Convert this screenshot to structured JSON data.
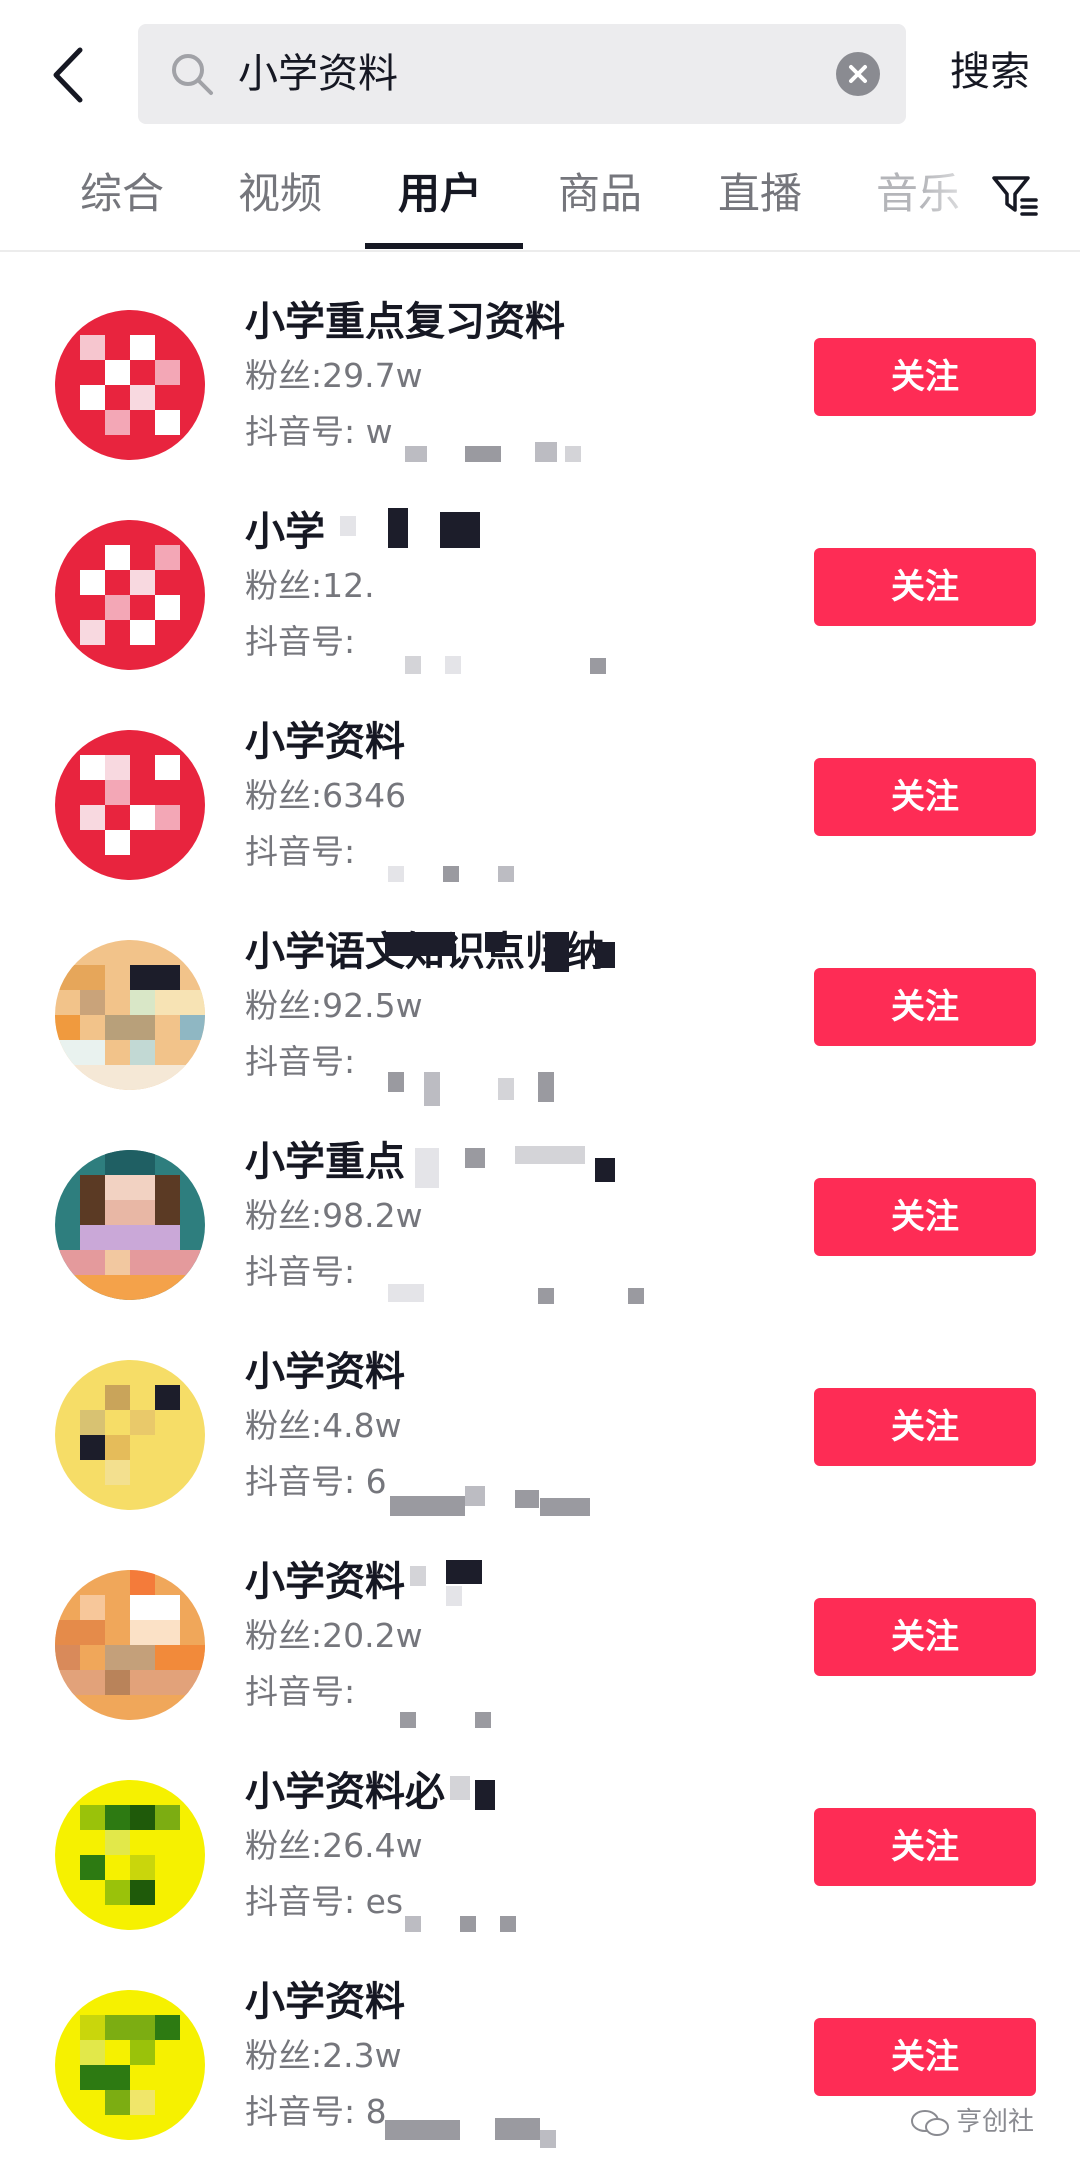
{
  "search": {
    "query": "小学资料",
    "submit_label": "搜索"
  },
  "tabs": [
    {
      "label": "综合",
      "active": false
    },
    {
      "label": "视频",
      "active": false
    },
    {
      "label": "用户",
      "active": true
    },
    {
      "label": "商品",
      "active": false
    },
    {
      "label": "直播",
      "active": false
    },
    {
      "label": "音乐",
      "active": false
    }
  ],
  "icons": {
    "back": "chevron-left-icon",
    "search": "search-icon",
    "clear": "close-circle-icon",
    "filter": "filter-icon"
  },
  "colors": {
    "accent": "#fe2c55",
    "text_primary": "#161823",
    "text_secondary": "#75767c",
    "search_bg": "#ececee"
  },
  "users": [
    {
      "name": "小学重点复习资料",
      "fans": "粉丝:29.7w",
      "id": "抖音号: w",
      "follow_label": "关注"
    },
    {
      "name": "小学",
      "fans": "粉丝:12.",
      "id": "抖音号: ",
      "follow_label": "关注"
    },
    {
      "name": "小学资料",
      "fans": "粉丝:6346",
      "id": "抖音号: ",
      "follow_label": "关注"
    },
    {
      "name": "小学语文知识点归纳",
      "fans": "粉丝:92.5w",
      "id": "抖音号: ",
      "follow_label": "关注"
    },
    {
      "name": "小学重点",
      "fans": "粉丝:98.2w",
      "id": "抖音号: ",
      "follow_label": "关注"
    },
    {
      "name": "小学资料",
      "fans": "粉丝:4.8w",
      "id": "抖音号: 6",
      "follow_label": "关注"
    },
    {
      "name": "小学资料",
      "fans": "粉丝:20.2w",
      "id": "抖音号: ",
      "follow_label": "关注"
    },
    {
      "name": "小学资料必",
      "fans": "粉丝:26.4w",
      "id": "抖音号: es",
      "follow_label": "关注"
    },
    {
      "name": "小学资料",
      "fans": "粉丝:2.3w",
      "id": "抖音号: 8",
      "follow_label": "关注"
    }
  ],
  "watermark": {
    "text": "亨创社"
  }
}
